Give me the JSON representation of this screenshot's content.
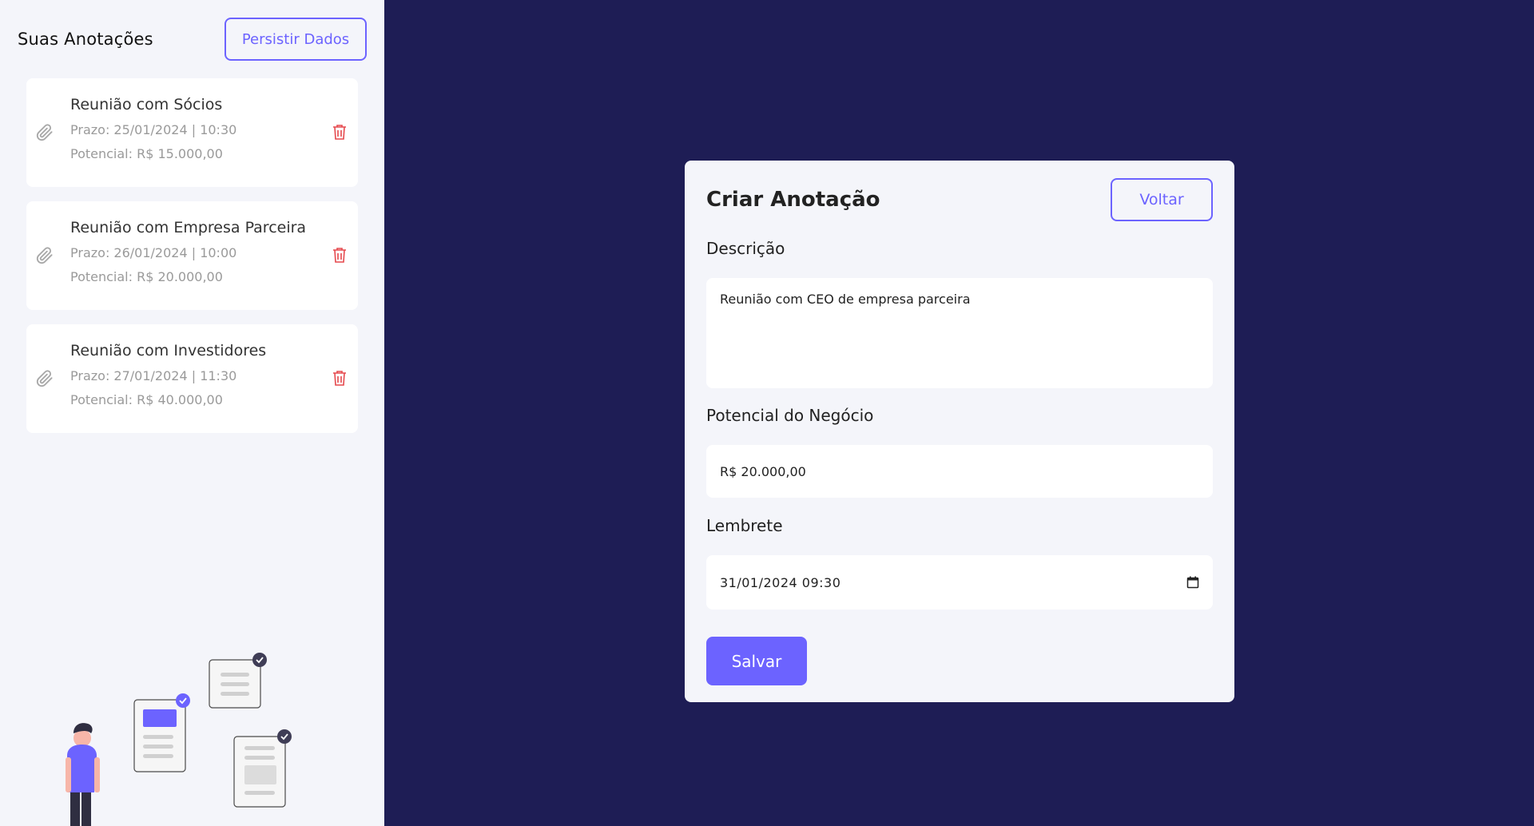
{
  "sidebar": {
    "title": "Suas Anotações",
    "persist_label": "Persistir Dados",
    "notes": [
      {
        "title": "Reunião com Sócios",
        "deadline": "Prazo: 25/01/2024 | 10:30",
        "potential": "Potencial: R$ 15.000,00"
      },
      {
        "title": "Reunião com Empresa Parceira",
        "deadline": "Prazo: 26/01/2024 | 10:00",
        "potential": "Potencial: R$ 20.000,00"
      },
      {
        "title": "Reunião com Investidores",
        "deadline": "Prazo: 27/01/2024 | 11:30",
        "potential": "Potencial: R$ 40.000,00"
      }
    ]
  },
  "form": {
    "title": "Criar Anotação",
    "back_label": "Voltar",
    "description_label": "Descrição",
    "description_value": "Reunião com CEO de empresa parceira",
    "potential_label": "Potencial do Negócio",
    "potential_value": "R$ 20.000,00",
    "reminder_label": "Lembrete",
    "reminder_value": "31/01/2024 09:30",
    "save_label": "Salvar"
  },
  "icons": {
    "note": "paperclip-icon",
    "delete": "trash-icon",
    "calendar": "calendar-icon"
  },
  "colors": {
    "accent": "#6c63ff",
    "background": "#1e1d55",
    "panel": "#f4f5fa",
    "delete": "#e5484d"
  }
}
